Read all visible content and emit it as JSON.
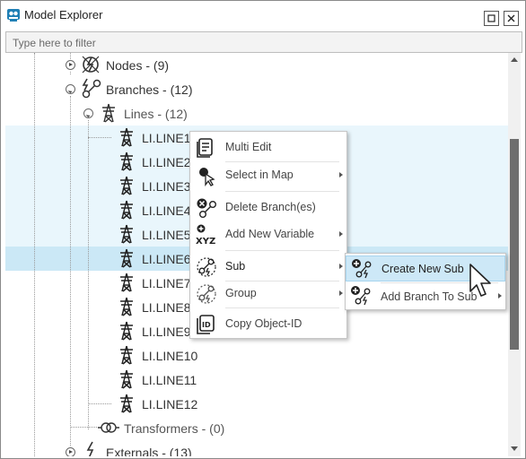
{
  "window": {
    "title": "Model Explorer",
    "maximize_glyph": "▫",
    "close_glyph": "✕"
  },
  "filter": {
    "placeholder": "Type here to filter",
    "value": ""
  },
  "tree": {
    "nodes": {
      "label": "Nodes - (9)",
      "icon": "nodes-icon",
      "state": "collapsed"
    },
    "branches": {
      "label": "Branches - (12)",
      "icon": "branches-icon",
      "state": "expanded"
    },
    "lines": {
      "label": "Lines - (12)",
      "icon": "transmission-tower-icon",
      "state": "expanded"
    },
    "line_items": [
      {
        "label": "LI.LINE1"
      },
      {
        "label": "LI.LINE2"
      },
      {
        "label": "LI.LINE3"
      },
      {
        "label": "LI.LINE4"
      },
      {
        "label": "LI.LINE5"
      },
      {
        "label": "LI.LINE6"
      },
      {
        "label": "LI.LINE7"
      },
      {
        "label": "LI.LINE8"
      },
      {
        "label": "LI.LINE9"
      },
      {
        "label": "LI.LINE10"
      },
      {
        "label": "LI.LINE11"
      },
      {
        "label": "LI.LINE12"
      }
    ],
    "transformers": {
      "label": "Transformers - (0)",
      "icon": "transformer-icon"
    },
    "externals": {
      "label": "Externals - (13)",
      "icon": "lightning-icon",
      "state": "collapsed"
    }
  },
  "context_menu": {
    "items": [
      {
        "label": "Multi Edit",
        "icon": "multi-edit-icon",
        "submenu": false
      },
      {
        "label": "Select in Map",
        "icon": "select-in-map-icon",
        "submenu": true
      },
      {
        "label": "Delete Branch(es)",
        "icon": "delete-branch-icon",
        "submenu": false
      },
      {
        "label": "Add New Variable",
        "icon": "add-variable-icon",
        "submenu": true
      },
      {
        "label": "Sub",
        "icon": "sub-icon",
        "submenu": true
      },
      {
        "label": "Group",
        "icon": "group-icon",
        "submenu": true
      },
      {
        "label": "Copy Object-ID",
        "icon": "copy-id-icon",
        "submenu": false
      }
    ]
  },
  "submenu": {
    "items": [
      {
        "label": "Create New Sub",
        "icon": "create-sub-icon",
        "hovered": true
      },
      {
        "label": "Add Branch To Sub",
        "icon": "add-branch-to-sub-icon",
        "submenu": true
      }
    ]
  },
  "colors": {
    "selected_row": "#cbe8f6",
    "multi_selected_row": "#e9f6fc",
    "hover_item": "#cde8f7",
    "scroll_thumb": "#6e6e6e"
  }
}
